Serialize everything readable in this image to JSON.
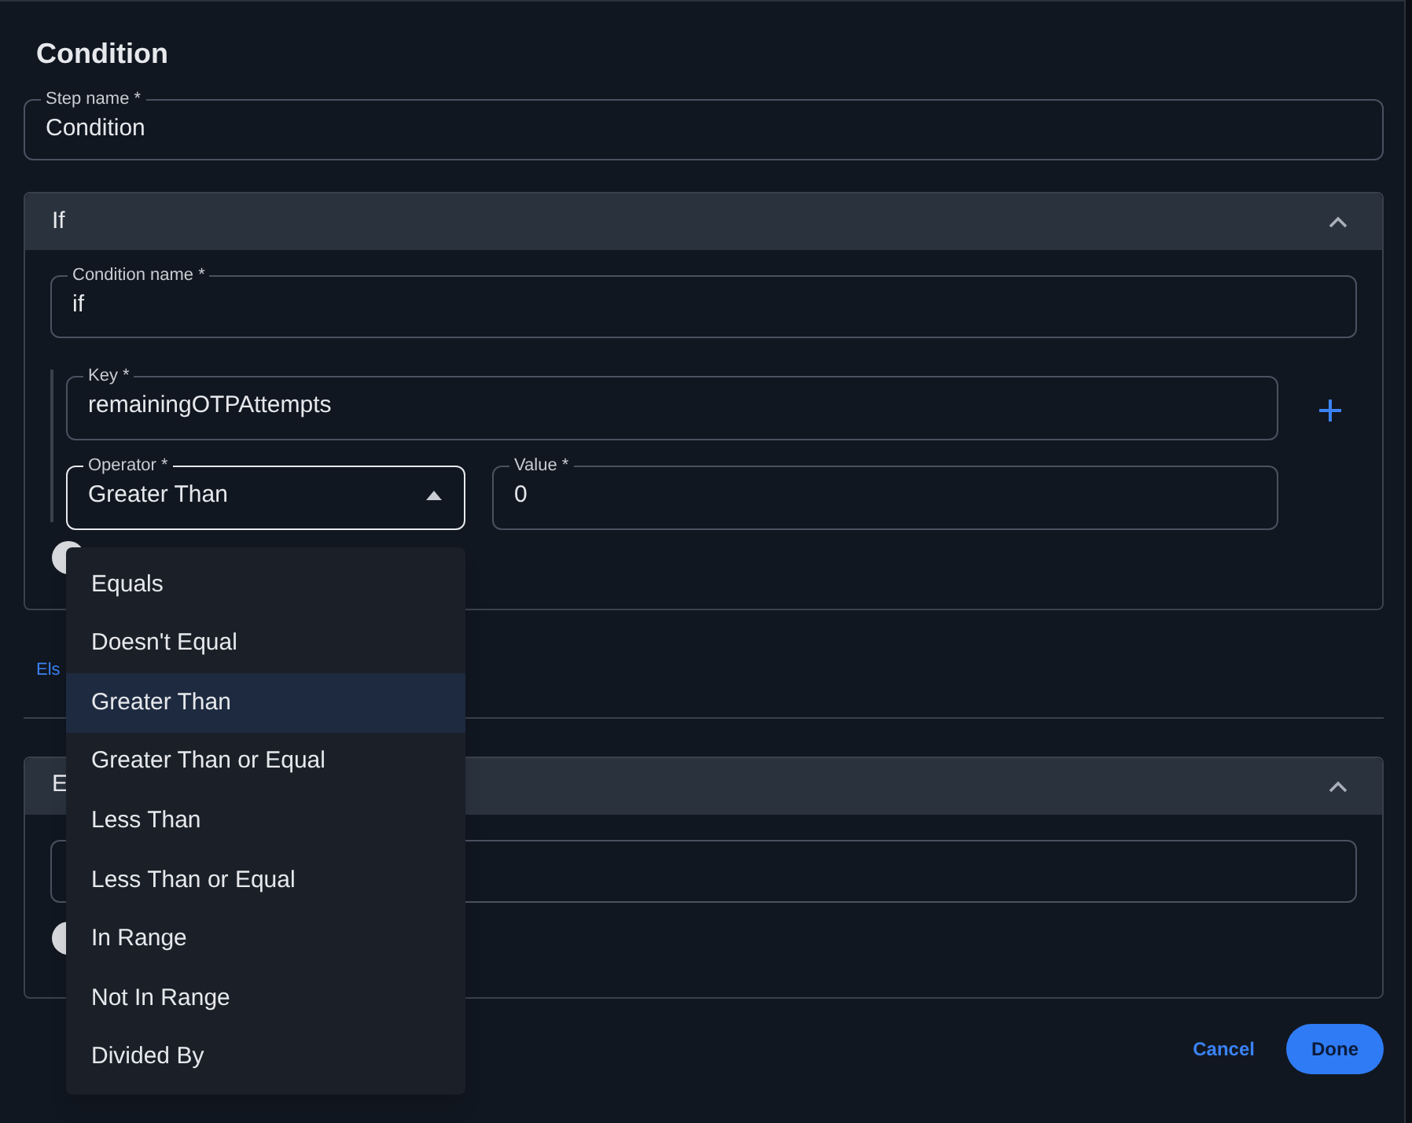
{
  "dialog": {
    "title": "Condition"
  },
  "step_name": {
    "label": "Step name *",
    "value": "Condition"
  },
  "if_panel": {
    "title": "If",
    "expanded": true,
    "condition_name": {
      "label": "Condition name *",
      "value": "if"
    },
    "key": {
      "label": "Key *",
      "value": "remainingOTPAttempts"
    },
    "operator": {
      "label": "Operator *",
      "value": "Greater Than",
      "open": true
    },
    "value": {
      "label": "Value *",
      "value": "0"
    },
    "toggle_on": false
  },
  "else_link": "Els",
  "else_panel": {
    "title": "E",
    "expanded": true,
    "toggle_on": false
  },
  "operator_menu": [
    {
      "label": "Equals",
      "selected": false
    },
    {
      "label": "Doesn't Equal",
      "selected": false
    },
    {
      "label": "Greater Than",
      "selected": true
    },
    {
      "label": "Greater Than or Equal",
      "selected": false
    },
    {
      "label": "Less Than",
      "selected": false
    },
    {
      "label": "Less Than or Equal",
      "selected": false
    },
    {
      "label": "In Range",
      "selected": false
    },
    {
      "label": "Not In Range",
      "selected": false
    },
    {
      "label": "Divided By",
      "selected": false
    }
  ],
  "buttons": {
    "cancel": "Cancel",
    "done": "Done"
  }
}
